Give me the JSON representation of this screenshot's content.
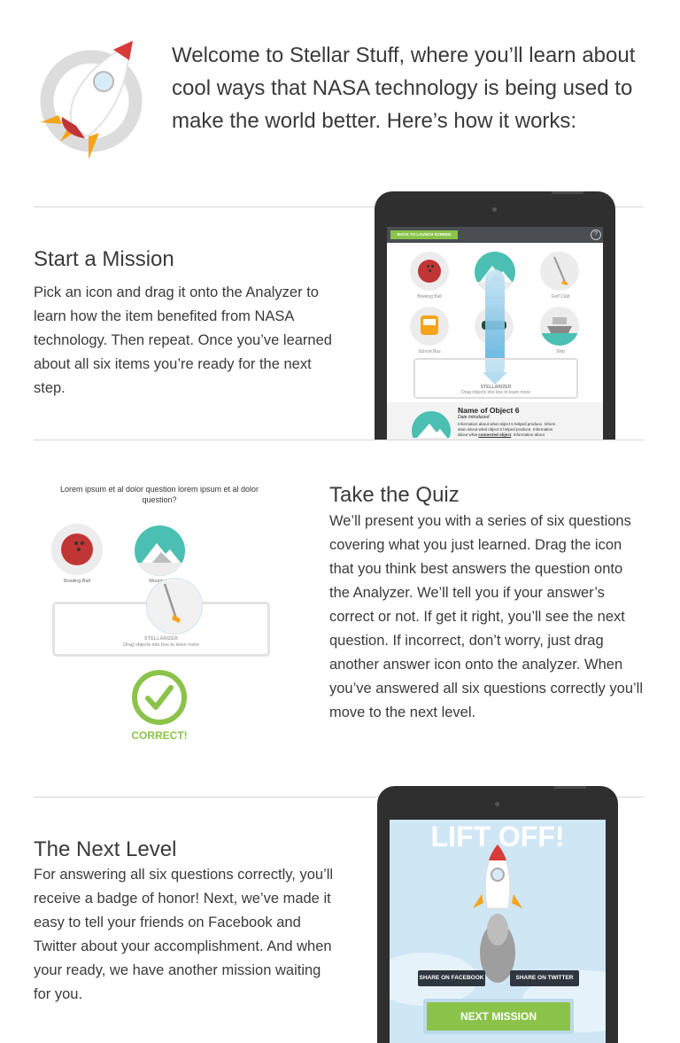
{
  "intro": {
    "text": "Welcome to Stellar Stuff, where you’ll learn about cool ways that NASA technology is being used to make the world better. Here’s how it works:"
  },
  "mission": {
    "title": "Start a Mission",
    "body": "Pick an icon and drag it onto the Analyzer to learn how the item benefited from NASA technology. Then repeat. Once you’ve learned about all six items you’re ready for the next step.",
    "tablet": {
      "back_button": "BACK TO LAUNCH SCREEN",
      "help": "?",
      "items": [
        "Bowling Ball",
        "Mountains",
        "Golf Club",
        "School Bus",
        "Glasses",
        "Ship"
      ],
      "analyzer_title": "STELLARIZER",
      "analyzer_hint": "Drag objects into box to learn more",
      "object_name": "Name of Object 6",
      "object_date": "Date Introduced",
      "object_info_1": "Information about what object 6 helped produce. Inform",
      "object_info_2": "ation about what object 6 helped produce. Information",
      "object_info_3_prefix": "about what ",
      "object_info_3_link": "connected object",
      "object_info_3_suffix": ". Information about"
    }
  },
  "quiz": {
    "title": "Take the Quiz",
    "body": "We’ll present you with a series of six questions covering what you just learned. Drag the icon that you think best answers the question onto the Analyzer. We’ll tell you if your answer’s correct or not. If get it right, you’ll see the next question. If incorrect, don’t worry, just drag another answer icon onto the analyzer. When you’ve answered all six questions correctly you’ll move to the next level.",
    "question": "Lorem ipsum et al dolor question lorem ipsum et al dolor question?",
    "items": [
      "Bowling Ball",
      "Mountains"
    ],
    "analyzer_title": "STELLARIZER",
    "analyzer_hint": "Drag objects into box to learn more",
    "correct_label": "CORRECT!"
  },
  "next_level": {
    "title": "The Next Level",
    "body": "For answering all six questions correctly, you’ll receive a badge of honor! Next, we’ve made it easy to tell your friends on Facebook and Twitter about your accomplishment. And when your ready, we have another mission waiting for you.",
    "tablet": {
      "headline": "LIFT OFF!",
      "share_facebook": "SHARE ON FACEBOOK",
      "share_twitter": "SHARE ON TWITTER",
      "next_mission": "NEXT MISSION"
    }
  },
  "colors": {
    "green": "#8bc34a",
    "rocket_red": "#d93a3a",
    "teal": "#4bbfb2",
    "sky": "#cfe6f5"
  }
}
